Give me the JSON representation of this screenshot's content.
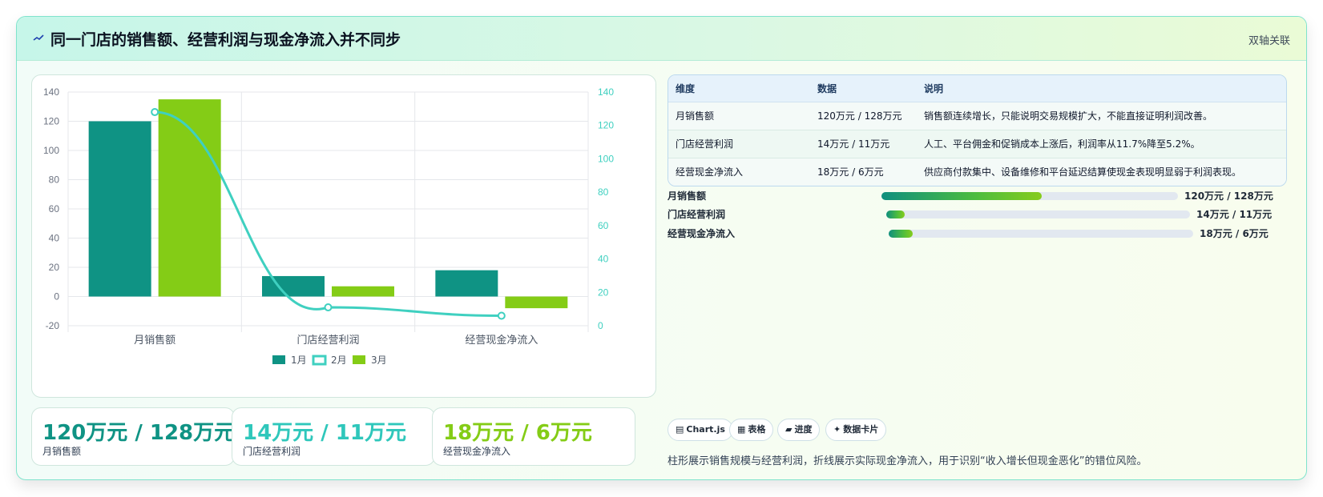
{
  "header": {
    "title": "同一门店的销售额、经营利润与现金净流入并不同步",
    "badge": "双轴关联",
    "icon": "wave-icon"
  },
  "chart_data": {
    "type": "bar",
    "categories": [
      "月销售额",
      "门店经营利润",
      "经营现金净流入"
    ],
    "series": [
      {
        "name": "1月",
        "type": "bar",
        "axis": "left",
        "color": "#0f9384",
        "values": [
          120,
          14,
          18
        ]
      },
      {
        "name": "2月",
        "type": "line",
        "axis": "right",
        "color": "#3fd0c0",
        "values": [
          128,
          11,
          6
        ]
      },
      {
        "name": "3月",
        "type": "bar",
        "axis": "left",
        "color": "#84cc16",
        "values": [
          135,
          7,
          -8
        ]
      }
    ],
    "left_axis": {
      "min": -20,
      "max": 140,
      "ticks": [
        -20,
        0,
        20,
        40,
        60,
        80,
        100,
        120,
        140
      ]
    },
    "right_axis": {
      "min": 0,
      "max": 140,
      "ticks": [
        0,
        20,
        40,
        60,
        80,
        100,
        120,
        140
      ]
    },
    "grid": true,
    "legend": "bottom-center"
  },
  "stats": [
    {
      "value": "120万元 / 128万元",
      "label": "月销售额",
      "color": "#0f9384"
    },
    {
      "value": "14万元 / 11万元",
      "label": "门店经营利润",
      "color": "#2fc7bb"
    },
    {
      "value": "18万元 / 6万元",
      "label": "经营现金净流入",
      "color": "#84cc16"
    }
  ],
  "table": {
    "headers": [
      "维度",
      "数据",
      "说明"
    ],
    "rows": [
      [
        "月销售额",
        "120万元 / 128万元",
        "销售额连续增长，只能说明交易规模扩大，不能直接证明利润改善。"
      ],
      [
        "门店经营利润",
        "14万元 / 11万元",
        "人工、平台佣金和促销成本上涨后，利润率从11.7%降至5.2%。"
      ],
      [
        "经营现金净流入",
        "18万元 / 6万元",
        "供应商付款集中、设备维修和平台延迟结算使现金表现明显弱于利润表现。"
      ]
    ]
  },
  "progress": [
    {
      "label": "月销售额",
      "value": "120万元 / 128万元",
      "fraction": 0.54
    },
    {
      "label": "门店经营利润",
      "value": "14万元 / 11万元",
      "fraction": 0.06
    },
    {
      "label": "经营现金净流入",
      "value": "18万元 / 6万元",
      "fraction": 0.08
    }
  ],
  "tags": [
    {
      "icon": "chart-icon",
      "glyph": "▤",
      "label": "Chart.js"
    },
    {
      "icon": "table-icon",
      "glyph": "▦",
      "label": "表格"
    },
    {
      "icon": "progress-icon",
      "glyph": "▰",
      "label": "进度"
    },
    {
      "icon": "sparkle-icon",
      "glyph": "✦",
      "label": "数据卡片"
    }
  ],
  "note": "柱形展示销售规模与经营利润，折线展示实际现金净流入，用于识别“收入增长但现金恶化”的错位风险。"
}
